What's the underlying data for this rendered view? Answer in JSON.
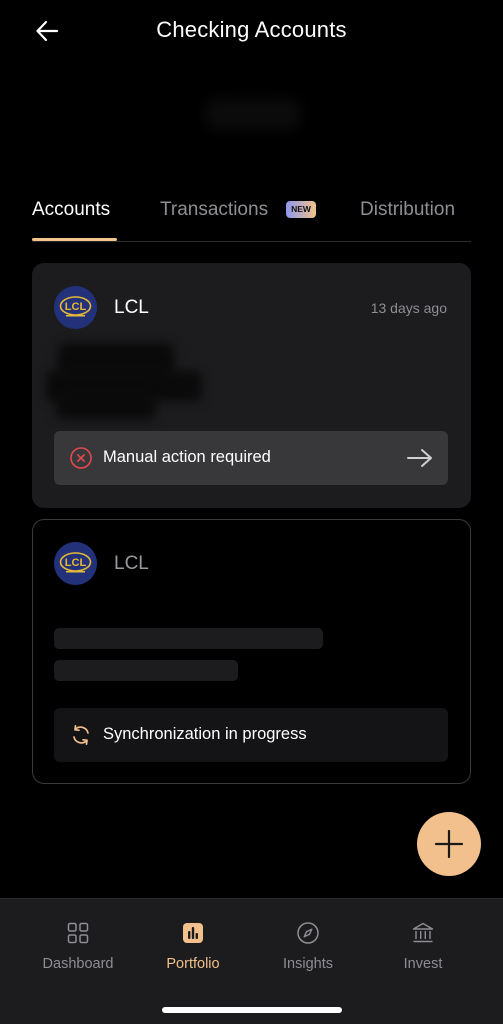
{
  "header": {
    "title": "Checking Accounts",
    "back_icon": "arrow-left-icon"
  },
  "tabs": [
    {
      "label": "Accounts",
      "active": true
    },
    {
      "label": "Transactions",
      "badge": "NEW"
    },
    {
      "label": "Distribution"
    }
  ],
  "accounts": [
    {
      "bank_name": "LCL",
      "logo_text": "LCL",
      "time_ago": "13 days ago",
      "status": {
        "label": "Manual action required",
        "icon": "error-circle-icon",
        "icon_color": "#e5484d",
        "action_icon": "arrow-right-icon"
      }
    },
    {
      "bank_name": "LCL",
      "logo_text": "LCL",
      "status": {
        "label": "Synchronization in progress",
        "icon": "sync-icon",
        "icon_color": "#f2c08c"
      }
    }
  ],
  "fab": {
    "icon": "plus-icon",
    "color": "#f2c08c"
  },
  "bottom_nav": [
    {
      "label": "Dashboard",
      "icon": "grid-icon"
    },
    {
      "label": "Portfolio",
      "icon": "bar-chart-icon",
      "active": true
    },
    {
      "label": "Insights",
      "icon": "compass-icon"
    },
    {
      "label": "Invest",
      "icon": "bank-icon"
    }
  ],
  "colors": {
    "accent": "#f2c08c",
    "background": "#000000",
    "card": "#1c1c1e",
    "error": "#e5484d"
  }
}
